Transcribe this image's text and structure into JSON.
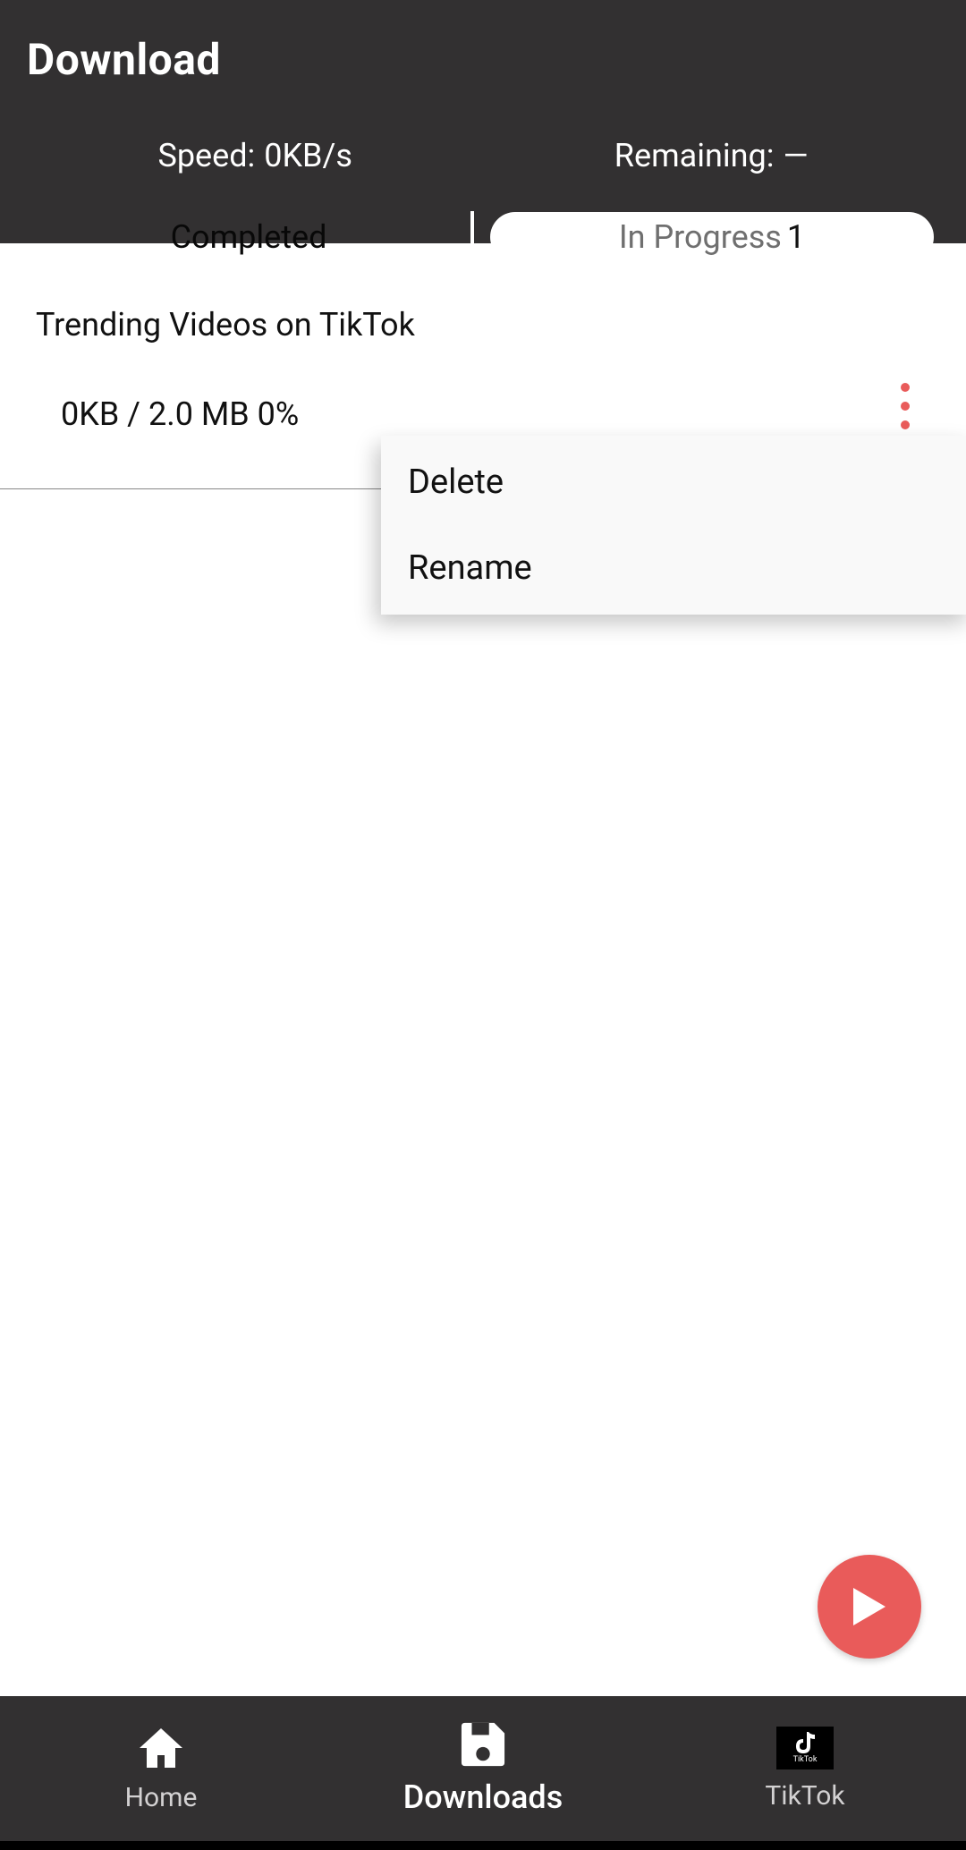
{
  "header": {
    "title": "Download",
    "speed_label": "Speed:",
    "speed_value": "0KB/s",
    "remaining_label": "Remaining:",
    "remaining_value": "—"
  },
  "tabs": {
    "completed": "Completed",
    "in_progress_label": "In Progress",
    "in_progress_count": "1"
  },
  "item": {
    "title": "Trending Videos on TikTok",
    "progress": "0KB / 2.0 MB 0%"
  },
  "popup": {
    "delete": "Delete",
    "rename": "Rename"
  },
  "nav": {
    "home": "Home",
    "downloads": "Downloads",
    "tiktok": "TikTok"
  }
}
